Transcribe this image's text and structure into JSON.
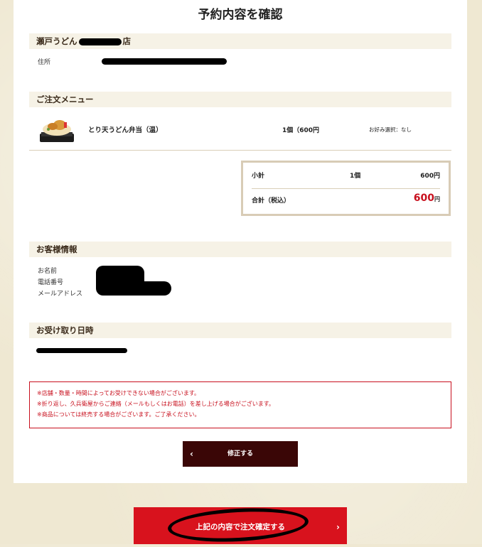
{
  "page_title": "予約内容を確認",
  "store": {
    "name_prefix": "瀬戸うどん",
    "name_suffix": "店",
    "address_label": "住所"
  },
  "order": {
    "section_title": "ご注文メニュー",
    "item": {
      "name": "とり天うどん弁当（温）",
      "quantity_price": "1個（600円",
      "options": "お好み選択：なし"
    },
    "summary": {
      "subtotal_label": "小計",
      "subtotal_qty": "1個",
      "subtotal_amount": "600円",
      "total_label": "合計（税込）",
      "total_amount": "600",
      "total_unit": "円"
    }
  },
  "customer": {
    "section_title": "お客様情報",
    "name_label": "お名前",
    "phone_label": "電話番号",
    "email_label": "メールアドレス"
  },
  "pickup": {
    "section_title": "お受け取り日時"
  },
  "notice": {
    "lines": [
      "※店舗・数量・時間によってお受けできない場合がございます。",
      "※折り返し、久兵衛屋からご連絡（メールもしくはお電話）を差し上げる場合がございます。",
      "※商品については終売する場合がございます。ご了承ください。"
    ]
  },
  "buttons": {
    "edit_label": "修正する",
    "edit_icon": "chevron-left-icon",
    "confirm_label": "上記の内容で注文確定する",
    "confirm_icon": "chevron-right-icon"
  },
  "colors": {
    "accent_red": "#d8121d",
    "dark_button": "#3a0606",
    "section_bg": "#f6f2e6",
    "page_bg": "#efe8d2"
  }
}
